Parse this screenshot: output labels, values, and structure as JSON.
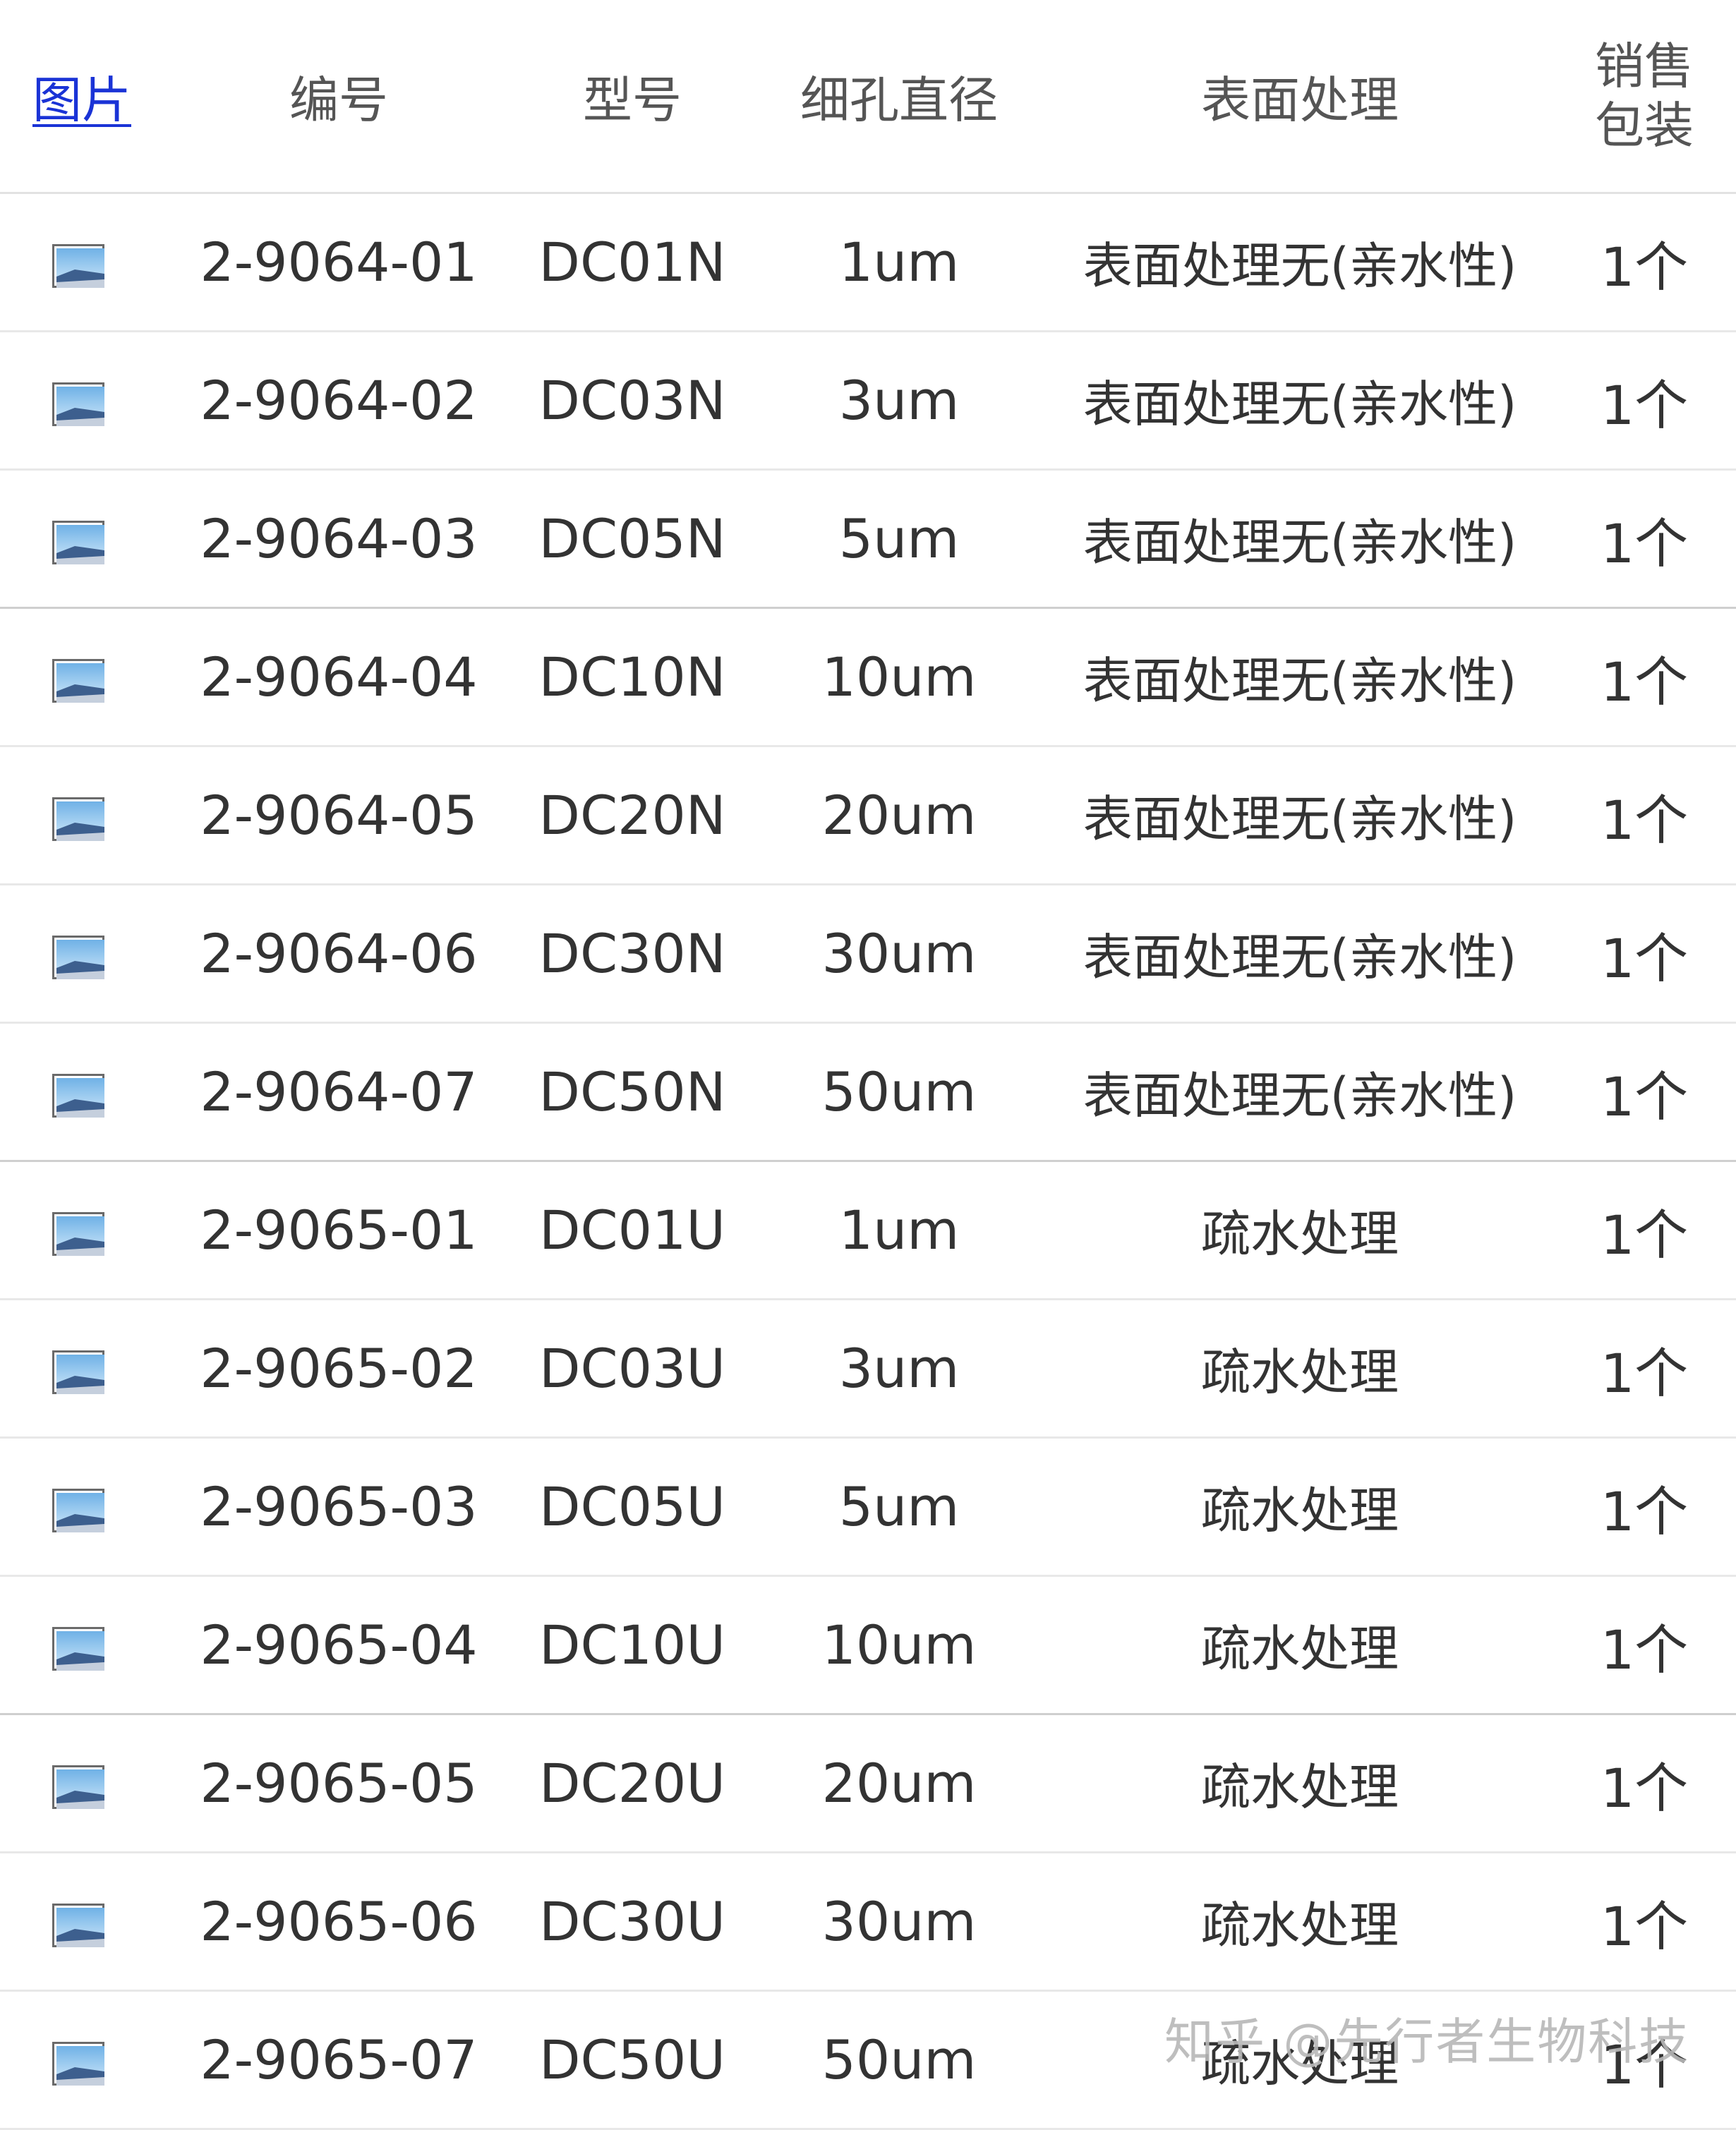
{
  "header": {
    "picture": "图片",
    "code": "编号",
    "model": "型号",
    "pore_diameter": "细孔直径",
    "surface_treatment": "表面处理",
    "pack_line1": "销售",
    "pack_line2": "包装"
  },
  "rows": [
    {
      "code": "2-9064-01",
      "model": "DC01N",
      "pore": "1um",
      "surface": "表面处理无(亲水性)",
      "pack": "1个"
    },
    {
      "code": "2-9064-02",
      "model": "DC03N",
      "pore": "3um",
      "surface": "表面处理无(亲水性)",
      "pack": "1个"
    },
    {
      "code": "2-9064-03",
      "model": "DC05N",
      "pore": "5um",
      "surface": "表面处理无(亲水性)",
      "pack": "1个"
    },
    {
      "code": "2-9064-04",
      "model": "DC10N",
      "pore": "10um",
      "surface": "表面处理无(亲水性)",
      "pack": "1个"
    },
    {
      "code": "2-9064-05",
      "model": "DC20N",
      "pore": "20um",
      "surface": "表面处理无(亲水性)",
      "pack": "1个"
    },
    {
      "code": "2-9064-06",
      "model": "DC30N",
      "pore": "30um",
      "surface": "表面处理无(亲水性)",
      "pack": "1个"
    },
    {
      "code": "2-9064-07",
      "model": "DC50N",
      "pore": "50um",
      "surface": "表面处理无(亲水性)",
      "pack": "1个"
    },
    {
      "code": "2-9065-01",
      "model": "DC01U",
      "pore": "1um",
      "surface": "疏水处理",
      "pack": "1个"
    },
    {
      "code": "2-9065-02",
      "model": "DC03U",
      "pore": "3um",
      "surface": "疏水处理",
      "pack": "1个"
    },
    {
      "code": "2-9065-03",
      "model": "DC05U",
      "pore": "5um",
      "surface": "疏水处理",
      "pack": "1个"
    },
    {
      "code": "2-9065-04",
      "model": "DC10U",
      "pore": "10um",
      "surface": "疏水处理",
      "pack": "1个"
    },
    {
      "code": "2-9065-05",
      "model": "DC20U",
      "pore": "20um",
      "surface": "疏水处理",
      "pack": "1个"
    },
    {
      "code": "2-9065-06",
      "model": "DC30U",
      "pore": "30um",
      "surface": "疏水处理",
      "pack": "1个"
    },
    {
      "code": "2-9065-07",
      "model": "DC50U",
      "pore": "50um",
      "surface": "疏水处理",
      "pack": "1个"
    }
  ],
  "watermark": "知乎 @先行者生物科技",
  "colors": {
    "link": "#1a33d6",
    "text": "#333333",
    "divider": "#e8e8e8"
  },
  "icons": {
    "row_image": "image-placeholder-icon"
  }
}
